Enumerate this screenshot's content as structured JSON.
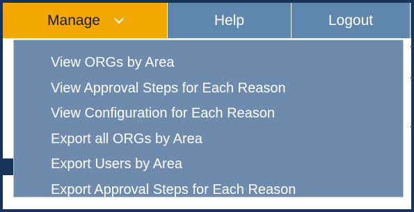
{
  "nav": {
    "items": [
      {
        "label": "Manage",
        "active": true
      },
      {
        "label": "Help"
      },
      {
        "label": "Logout"
      }
    ]
  },
  "dropdown": {
    "items": [
      {
        "label": "View ORGs by Area"
      },
      {
        "label": "View Approval Steps for Each Reason"
      },
      {
        "label": "View Configuration for Each Reason"
      },
      {
        "label": "Export all ORGs by Area"
      },
      {
        "label": "Export Users by Area"
      },
      {
        "label": "Export Approval Steps for Each Reason"
      }
    ]
  },
  "colors": {
    "border": "#163458",
    "menubar": "#5f87ae",
    "active": "#f2a800",
    "dropdown_bg": "#6e8bad",
    "text": "#ffffff"
  }
}
